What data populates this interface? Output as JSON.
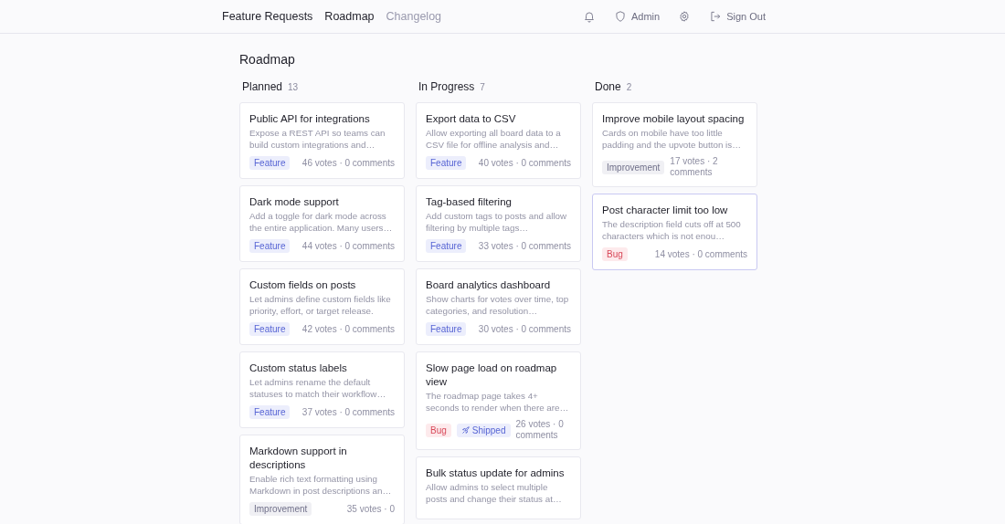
{
  "header": {
    "brand": "Feature Requests",
    "nav": [
      {
        "label": "Roadmap",
        "selected": true
      },
      {
        "label": "Changelog",
        "selected": false
      }
    ],
    "actions": [
      {
        "kind": "bell"
      },
      {
        "kind": "shield",
        "label": "Admin"
      },
      {
        "kind": "gear"
      },
      {
        "kind": "signout",
        "label": "Sign Out"
      }
    ]
  },
  "page_title": "Roadmap",
  "columns": [
    {
      "name": "Planned",
      "count": "13",
      "cards": [
        {
          "title": "Public API for integrations",
          "description": "Expose a REST API so teams can build custom integrations and…",
          "tags": [
            {
              "kind": "feature",
              "label": "Feature"
            }
          ],
          "meta": "46 votes · 0 comments",
          "selected": false
        },
        {
          "title": "Dark mode support",
          "description": "Add a toggle for dark mode across the entire application. Many users…",
          "tags": [
            {
              "kind": "feature",
              "label": "Feature"
            }
          ],
          "meta": "44 votes · 0 comments",
          "selected": false
        },
        {
          "title": "Custom fields on posts",
          "description": "Let admins define custom fields like priority, effort, or target release.",
          "tags": [
            {
              "kind": "feature",
              "label": "Feature"
            }
          ],
          "meta": "42 votes · 0 comments",
          "selected": false
        },
        {
          "title": "Custom status labels",
          "description": "Let admins rename the default statuses to match their workflow…",
          "tags": [
            {
              "kind": "feature",
              "label": "Feature"
            }
          ],
          "meta": "37 votes · 0 comments",
          "selected": false
        },
        {
          "title": "Markdown support in descriptions",
          "description": "Enable rich text formatting using Markdown in post descriptions an…",
          "tags": [
            {
              "kind": "improvement",
              "label": "Improvement"
            }
          ],
          "meta": "35 votes · 0",
          "selected": false
        }
      ]
    },
    {
      "name": "In Progress",
      "count": "7",
      "cards": [
        {
          "title": "Export data to CSV",
          "description": "Allow exporting all board data to a CSV file for offline analysis and…",
          "tags": [
            {
              "kind": "feature",
              "label": "Feature"
            }
          ],
          "meta": "40 votes · 0 comments",
          "selected": false
        },
        {
          "title": "Tag-based filtering",
          "description": "Add custom tags to posts and allow filtering by multiple tags…",
          "tags": [
            {
              "kind": "feature",
              "label": "Feature"
            }
          ],
          "meta": "33 votes · 0 comments",
          "selected": false
        },
        {
          "title": "Board analytics dashboard",
          "description": "Show charts for votes over time, top categories, and resolution…",
          "tags": [
            {
              "kind": "feature",
              "label": "Feature"
            }
          ],
          "meta": "30 votes · 0 comments",
          "selected": false
        },
        {
          "title": "Slow page load on roadmap view",
          "description": "The roadmap page takes 4+ seconds to render when there are…",
          "tags": [
            {
              "kind": "bug",
              "label": "Bug"
            },
            {
              "kind": "shipped",
              "label": "Shipped"
            }
          ],
          "meta": "26 votes · 0 comments",
          "selected": false
        },
        {
          "title": "Bulk status update for admins",
          "description": "Allow admins to select multiple posts and change their status at…",
          "selected": false
        }
      ]
    },
    {
      "name": "Done",
      "count": "2",
      "cards": [
        {
          "title": "Improve mobile layout spacing",
          "description": "Cards on mobile have too little padding and the upvote button is…",
          "tags": [
            {
              "kind": "improvement",
              "label": "Improvement"
            }
          ],
          "meta": "17 votes · 2 comments",
          "selected": false
        },
        {
          "title": "Post character limit too low",
          "description": "The description field cuts off at 500 characters which is not enou…",
          "tags": [
            {
              "kind": "bug",
              "label": "Bug"
            }
          ],
          "meta": "14 votes · 0 comments",
          "selected": true
        }
      ]
    }
  ]
}
